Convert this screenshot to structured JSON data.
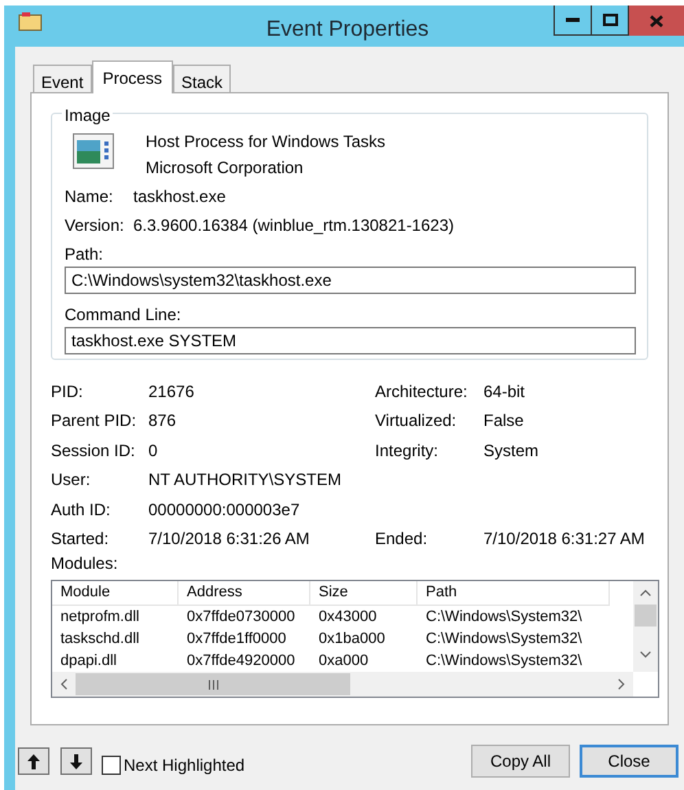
{
  "window": {
    "title": "Event Properties"
  },
  "tabs": [
    {
      "label": "Event",
      "selected": false
    },
    {
      "label": "Process",
      "selected": true
    },
    {
      "label": "Stack",
      "selected": false
    }
  ],
  "image": {
    "heading": "Image",
    "description": "Host Process for Windows Tasks",
    "company": "Microsoft Corporation",
    "name_label": "Name:",
    "name": "taskhost.exe",
    "version_label": "Version:",
    "version": "6.3.9600.16384 (winblue_rtm.130821-1623)",
    "path_label": "Path:",
    "path": "C:\\Windows\\system32\\taskhost.exe",
    "command_line_label": "Command Line:",
    "command_line": "taskhost.exe SYSTEM"
  },
  "properties": [
    {
      "label": "PID:",
      "value": "21676",
      "right_label": "Architecture:",
      "right_value": "64-bit"
    },
    {
      "label": "Parent PID:",
      "value": "876",
      "right_label": "Virtualized:",
      "right_value": "False"
    },
    {
      "label": "Session ID:",
      "value": "0",
      "right_label": "Integrity:",
      "right_value": "System"
    },
    {
      "label": "User:",
      "value": "NT AUTHORITY\\SYSTEM"
    },
    {
      "label": "Auth ID:",
      "value": "00000000:000003e7"
    },
    {
      "label": "Started:",
      "value": "7/10/2018 6:31:26 AM",
      "right_label": "Ended:",
      "right_value": "7/10/2018 6:31:27 AM"
    }
  ],
  "modules_label": "Modules:",
  "modules": {
    "columns": [
      "Module",
      "Address",
      "Size",
      "Path"
    ],
    "rows": [
      [
        "netprofm.dll",
        "0x7ffde0730000",
        "0x43000",
        "C:\\Windows\\System32\\"
      ],
      [
        "taskschd.dll",
        "0x7ffde1ff0000",
        "0x1ba000",
        "C:\\Windows\\System32\\"
      ],
      [
        "dpapi.dll",
        "0x7ffde4920000",
        "0xa000",
        "C:\\Windows\\System32\\"
      ]
    ]
  },
  "next_highlighted": {
    "label": "Next Highlighted",
    "checked": false
  },
  "buttons": [
    {
      "label": "Copy All",
      "default": false
    },
    {
      "label": "Close",
      "default": true
    }
  ]
}
